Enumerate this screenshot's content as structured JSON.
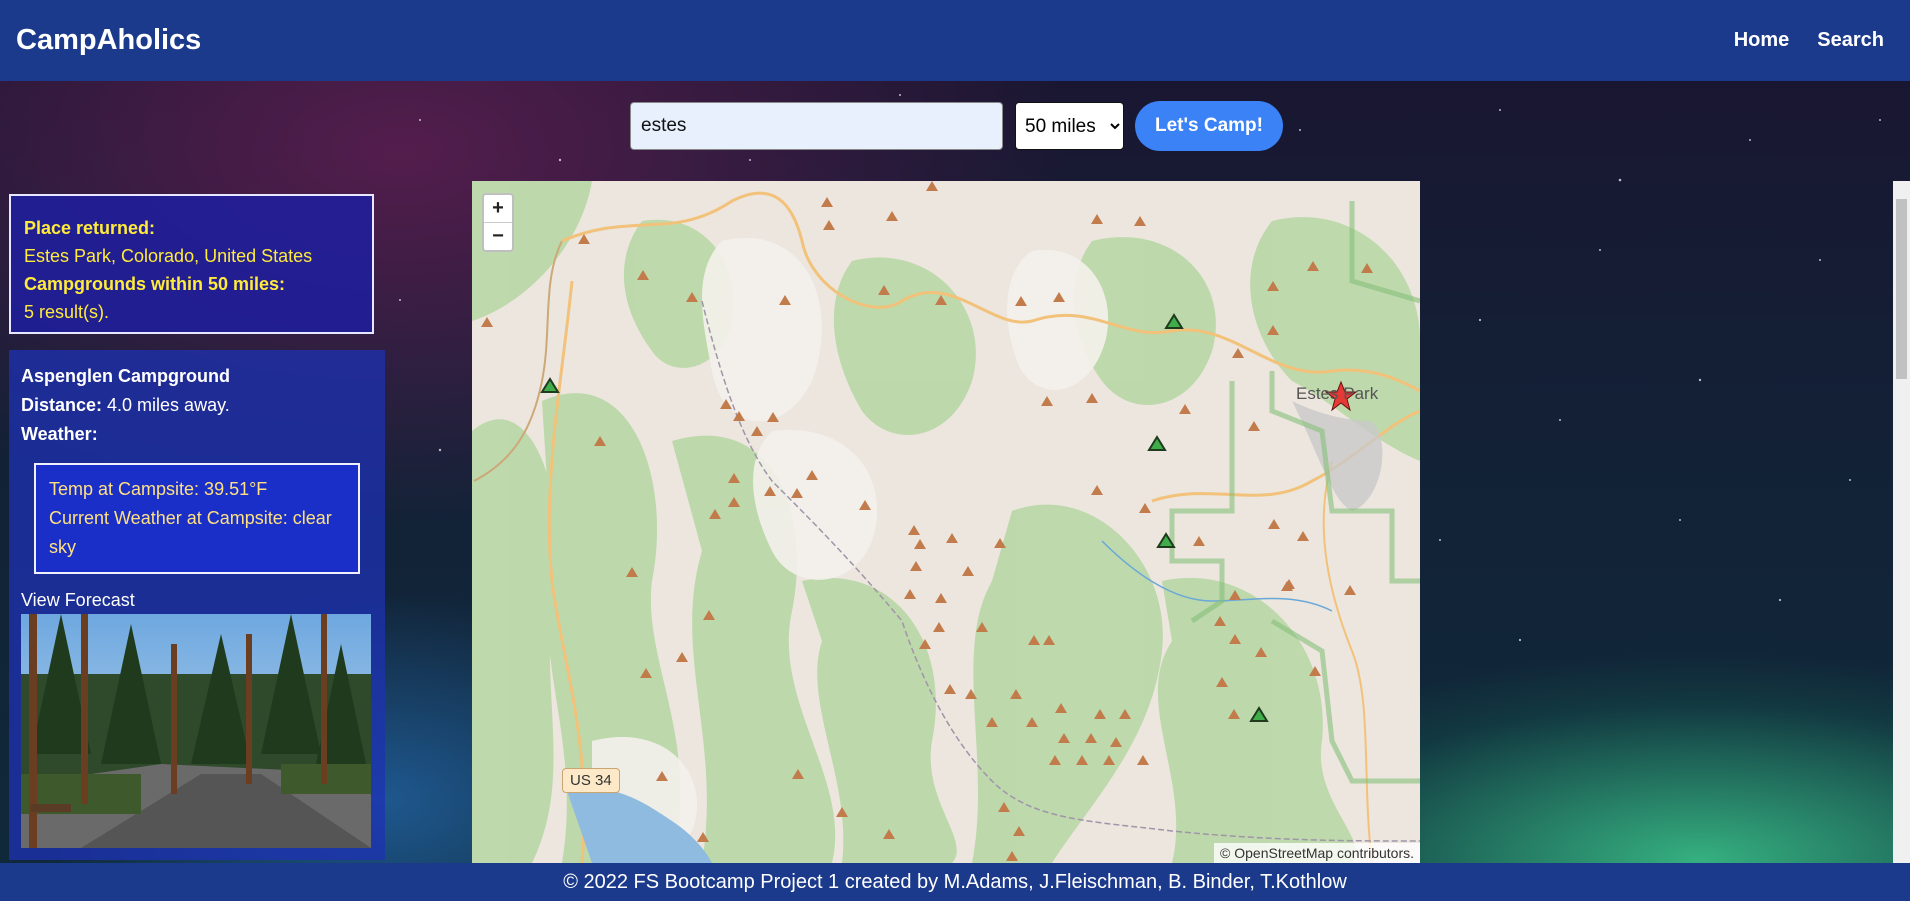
{
  "header": {
    "brand": "CampAholics",
    "nav": [
      "Home",
      "Search"
    ]
  },
  "search": {
    "query": "estes",
    "range_selected": "50 miles",
    "range_options": [
      "50 miles"
    ],
    "submit_label": "Let's Camp!"
  },
  "summary": {
    "place_label": "Place returned:",
    "place_value": "Estes Park, Colorado, United States",
    "count_label": "Campgrounds within 50 miles:",
    "count_value": "5 result(s)."
  },
  "result": {
    "name": "Aspenglen Campground",
    "distance_label": "Distance:",
    "distance_value": " 4.0 miles away.",
    "weather_label": "Weather:",
    "temp": "Temp at Campsite: 39.51°F",
    "current": "Current Weather at Campsite: clear sky",
    "forecast_link": "View Forecast"
  },
  "map": {
    "zoom_in": "+",
    "zoom_out": "−",
    "town_label": "Estes Park",
    "route_label": "US 34",
    "attribution": "© OpenStreetMap contributors."
  },
  "footer": {
    "text": "© 2022 FS Bootcamp Project 1 created by M.Adams, J.Fleischman, B. Binder, T.Kothlow"
  }
}
